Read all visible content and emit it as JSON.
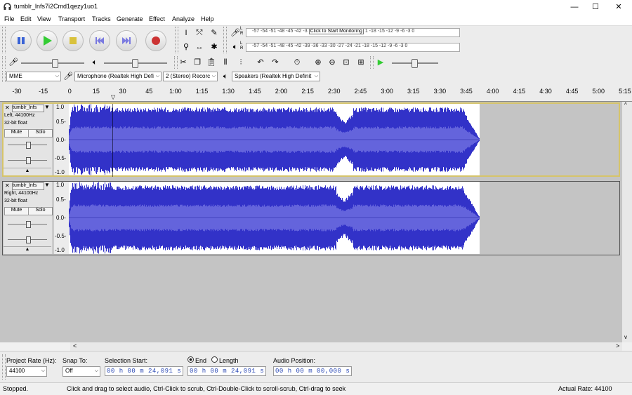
{
  "window": {
    "title": "tumblr_lnfs7i2Cmd1qezy1uo1",
    "minimize": "—",
    "maximize": "☐",
    "close": "✕"
  },
  "menu": [
    "File",
    "Edit",
    "View",
    "Transport",
    "Tracks",
    "Generate",
    "Effect",
    "Analyze",
    "Help"
  ],
  "meters": {
    "record_scale": "-57 -54 -51 -48 -45 -42 -3",
    "record_prompt": "Click to Start Monitoring",
    "record_scale_tail": "1 -18 -15 -12 -9 -6 -3 0",
    "play_scale": "-57 -54 -51 -48 -45 -42 -39 -36 -33 -30 -27 -24 -21 -18 -15 -12 -9 -6 -3 0"
  },
  "devices": {
    "host": "MME",
    "microphone": "Microphone (Realtek High Defi",
    "channels": "2 (Stereo) Recorc",
    "speakers": "Speakers (Realtek High Definit"
  },
  "ruler": [
    "-30",
    "-15",
    "0",
    "15",
    "30",
    "45",
    "1:00",
    "1:15",
    "1:30",
    "1:45",
    "2:00",
    "2:15",
    "2:30",
    "2:45",
    "3:00",
    "3:15",
    "3:30",
    "3:45",
    "4:00",
    "4:15",
    "4:30",
    "4:45",
    "5:00",
    "5:15"
  ],
  "tracks": [
    {
      "name": "tumblr_lnfs",
      "info1": "Left, 44100Hz",
      "info2": "32-bit float",
      "mute": "Mute",
      "solo": "Solo",
      "scale": [
        "1.0",
        "0.5-",
        "0.0-",
        "-0.5-",
        "-1.0"
      ]
    },
    {
      "name": "tumblr_lnfs",
      "info1": "Right, 44100Hz",
      "info2": "32-bit float",
      "mute": "Mute",
      "solo": "Solo",
      "scale": [
        "1.0",
        "0.5-",
        "0.0-",
        "-0.5-",
        "-1.0"
      ]
    }
  ],
  "selection": {
    "project_rate_label": "Project Rate (Hz):",
    "project_rate": "44100",
    "snap_label": "Snap To:",
    "snap_value": "Off",
    "sel_start_label": "Selection Start:",
    "end_label": "End",
    "length_label": "Length",
    "audio_pos_label": "Audio Position:",
    "sel_start": "00 h 00 m 24,091 s",
    "sel_end": "00 h 00 m 24,091 s",
    "audio_pos": "00 h 00 m 00,000 s"
  },
  "status": {
    "state": "Stopped.",
    "hint": "Click and drag to select audio, Ctrl-Click to scrub, Ctrl-Double-Click to scroll-scrub, Ctrl-drag to seek",
    "rate": "Actual Rate: 44100"
  },
  "colors": {
    "wave": "#3232c8",
    "wave_rms": "#6464dc",
    "play_green": "#3c3",
    "record_red": "#c33"
  }
}
